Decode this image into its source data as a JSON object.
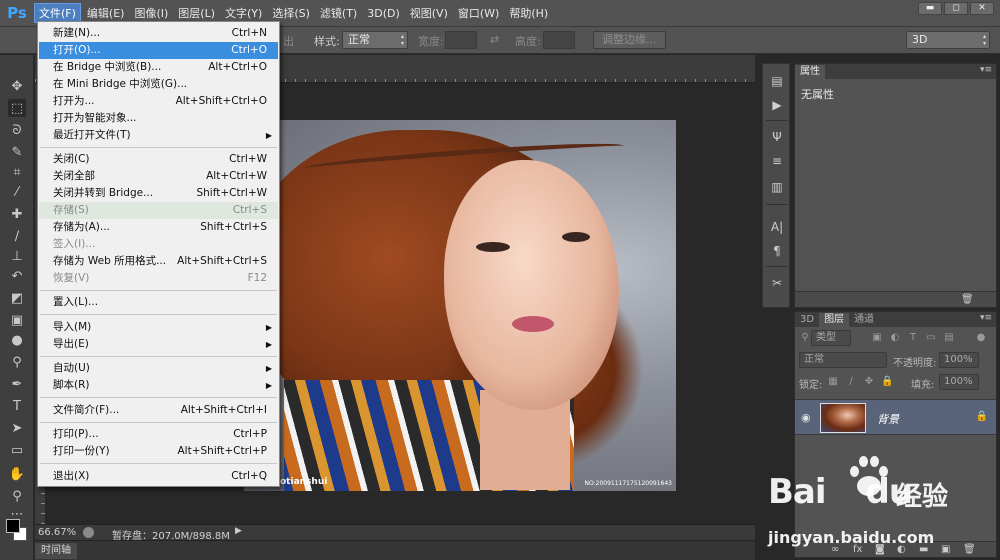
{
  "app": {
    "logo": "Ps"
  },
  "menubar": {
    "items": [
      "文件(F)",
      "编辑(E)",
      "图像(I)",
      "图层(L)",
      "文字(Y)",
      "选择(S)",
      "滤镜(T)",
      "3D(D)",
      "视图(V)",
      "窗口(W)",
      "帮助(H)"
    ],
    "active_index": 0
  },
  "window_controls": {
    "minimize": "▬",
    "restore": "◻",
    "close": "✕"
  },
  "options_bar": {
    "feather_fragment": "出",
    "style_label": "样式:",
    "style_value": "正常",
    "width_label": "宽度:",
    "swap_glyph": "⇄",
    "height_label": "高度:",
    "refine_edge_button": "调整边缘...",
    "workspace_value": "3D"
  },
  "file_menu": {
    "items": [
      {
        "label": "新建(N)...",
        "shortcut": "Ctrl+N"
      },
      {
        "label": "打开(O)...",
        "shortcut": "Ctrl+O",
        "highlighted": true
      },
      {
        "label": "在 Bridge 中浏览(B)...",
        "shortcut": "Alt+Ctrl+O"
      },
      {
        "label": "在 Mini Bridge 中浏览(G)...",
        "shortcut": ""
      },
      {
        "label": "打开为...",
        "shortcut": "Alt+Shift+Ctrl+O"
      },
      {
        "label": "打开为智能对象...",
        "shortcut": ""
      },
      {
        "label": "最近打开文件(T)",
        "shortcut": "",
        "submenu": true
      },
      {
        "label": "关闭(C)",
        "shortcut": "Ctrl+W"
      },
      {
        "label": "关闭全部",
        "shortcut": "Alt+Ctrl+W"
      },
      {
        "label": "关闭并转到 Bridge...",
        "shortcut": "Shift+Ctrl+W"
      },
      {
        "label": "存储(S)",
        "shortcut": "Ctrl+S",
        "disabled": true
      },
      {
        "label": "存储为(A)...",
        "shortcut": "Shift+Ctrl+S"
      },
      {
        "label": "签入(I)...",
        "shortcut": "",
        "disabled": true
      },
      {
        "label": "存储为 Web 所用格式...",
        "shortcut": "Alt+Shift+Ctrl+S"
      },
      {
        "label": "恢复(V)",
        "shortcut": "F12",
        "disabled": true
      },
      {
        "label": "置入(L)...",
        "shortcut": ""
      },
      {
        "label": "导入(M)",
        "shortcut": "",
        "submenu": true
      },
      {
        "label": "导出(E)",
        "shortcut": "",
        "submenu": true
      },
      {
        "label": "自动(U)",
        "shortcut": "",
        "submenu": true
      },
      {
        "label": "脚本(R)",
        "shortcut": "",
        "submenu": true
      },
      {
        "label": "文件简介(F)...",
        "shortcut": "Alt+Shift+Ctrl+I"
      },
      {
        "label": "打印(P)...",
        "shortcut": "Ctrl+P"
      },
      {
        "label": "打印一份(Y)",
        "shortcut": "Alt+Shift+Ctrl+P"
      },
      {
        "label": "退出(X)",
        "shortcut": "Ctrl+Q"
      }
    ]
  },
  "canvas": {
    "watermark_left": "otianshui",
    "watermark_right": "NO:20091117175120091643"
  },
  "status_bar": {
    "zoom": "66.67%",
    "doc_info": "暂存盘：207.0M/898.8M",
    "arrow": "▶"
  },
  "timeline": {
    "tab_label": "时间轴"
  },
  "properties_panel": {
    "tab_label": "属性",
    "menu_glyph": "▾≡",
    "empty_text": "无属性"
  },
  "layers_panel": {
    "tabs": [
      "3D",
      "图层",
      "通道"
    ],
    "active_tab_index": 1,
    "menu_glyph": "▾≡",
    "filter_type": "类型",
    "blend_mode": "正常",
    "opacity_label": "不透明度:",
    "opacity_value": "100%",
    "lock_label": "锁定:",
    "fill_label": "填充:",
    "fill_value": "100%",
    "layer": {
      "name": "背景",
      "visible_glyph": "◉",
      "lock_glyph": "🔒"
    }
  },
  "page_watermark": {
    "brand_left": "Bai",
    "brand_mid": "du",
    "brand_cn": "经验",
    "url": "jingyan.baidu.com"
  }
}
